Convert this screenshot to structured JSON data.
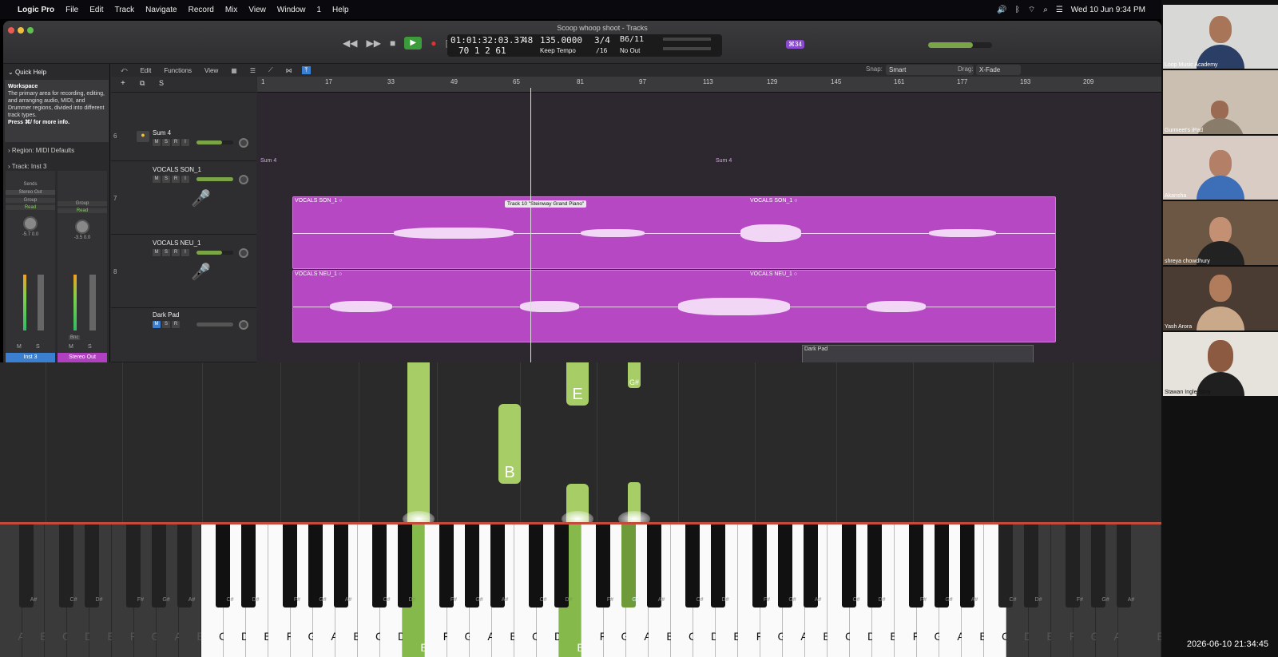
{
  "menubar": {
    "items": [
      "Logic Pro",
      "File",
      "Edit",
      "Track",
      "Navigate",
      "Record",
      "Mix",
      "View",
      "Window",
      "1",
      "Help"
    ],
    "datetime": "Wed 10 Jun  9:34 PM"
  },
  "window": {
    "title": "Scoop whoop shoot - Tracks",
    "lcd": {
      "time": "01:01:32:03.37",
      "bars": "70  1  2    61",
      "bpm_top": "48",
      "tempo": "135.0000",
      "tempo_mode": "Keep Tempo",
      "sig_top": "3/4",
      "sig_bottom": "/16",
      "key_top": "B6/11",
      "key_bottom": "No Out",
      "count": "⌘34"
    },
    "toolbar": {
      "edit": "Edit",
      "functions": "Functions",
      "view": "View",
      "snap_label": "Snap:",
      "snap_value": "Smart",
      "drag_label": "Drag:",
      "drag_value": "X-Fade"
    }
  },
  "left_panel": {
    "quick_help_title": "Quick Help",
    "qh_heading": "Workspace",
    "qh_body": "The primary area for recording, editing, and arranging audio, MIDI, and Drummer regions, divided into different track types.",
    "qh_hint": "Press ⌘/ for more info.",
    "region_label": "Region: MIDI Defaults",
    "track_label": "Track:  Inst 3",
    "strips": [
      {
        "sends": "Sends",
        "out": "Stereo Out",
        "group": "Group",
        "read": "Read",
        "vals": "-5.7   0.0",
        "name": "Inst 3",
        "color": "#3b7fd1"
      },
      {
        "sends": "",
        "out": "",
        "group": "Group",
        "read": "Read",
        "vals": "-3.5   0.0",
        "name": "Stereo Out",
        "color": "#b040c0",
        "bnc": "Bnc"
      }
    ]
  },
  "ruler": [
    "1",
    "17",
    "33",
    "49",
    "65",
    "81",
    "97",
    "113",
    "129",
    "145",
    "161",
    "177",
    "193",
    "209"
  ],
  "tracks": [
    {
      "num": "6",
      "name": "Sum 4"
    },
    {
      "num": "7",
      "name": "VOCALS SON_1"
    },
    {
      "num": "8",
      "name": "VOCALS NEU_1"
    },
    {
      "num": "",
      "name": "Dark Pad"
    }
  ],
  "regions": {
    "sum_a": "Sum 4",
    "sum_b": "Sum 4",
    "son_a": "VOCALS SON_1  ○",
    "son_b": "VOCALS SON_1  ○",
    "neu_a": "VOCALS NEU_1  ○",
    "neu_b": "VOCALS NEU_1  ○",
    "dark": "Dark Pad"
  },
  "tooltip": "Track 10 \"Steinway Grand Piano\"",
  "notes": [
    {
      "label": "E"
    },
    {
      "label": "B"
    },
    {
      "label": "E"
    },
    {
      "label": "G#"
    }
  ],
  "participants": [
    "Loop Music Academy",
    "Gurmeet's iPad",
    "Akansha",
    "shreya chowdhury",
    "Yash Arora",
    "Stawan Ingle Stivy"
  ],
  "timestamp": "2026-06-10 21:34:45",
  "keyboard_white": [
    "A",
    "B",
    "C",
    "D",
    "E",
    "F",
    "G",
    "A",
    "B",
    "C",
    "D",
    "E",
    "F",
    "G",
    "A",
    "B",
    "C",
    "D",
    "E",
    "F",
    "G",
    "A",
    "B",
    "C",
    "D",
    "E",
    "F",
    "G",
    "A",
    "B",
    "C",
    "D",
    "E",
    "F",
    "G",
    "A",
    "B",
    "C",
    "D",
    "E",
    "F",
    "G",
    "A",
    "B",
    "C",
    "D",
    "E",
    "F",
    "G",
    "A",
    "B"
  ],
  "keyboard_black": [
    "A#",
    "C#",
    "D#",
    "F#",
    "G#",
    "A#",
    "C#",
    "D#",
    "F#",
    "G#",
    "A#",
    "C#",
    "D#",
    "F#",
    "G#",
    "A#",
    "C#",
    "D#",
    "F#",
    "G#",
    "A#",
    "C#",
    "D#",
    "F#",
    "G#",
    "A#",
    "C#",
    "D#",
    "F#",
    "G#",
    "A#",
    "C#",
    "D#",
    "F#",
    "G#",
    "A#"
  ]
}
